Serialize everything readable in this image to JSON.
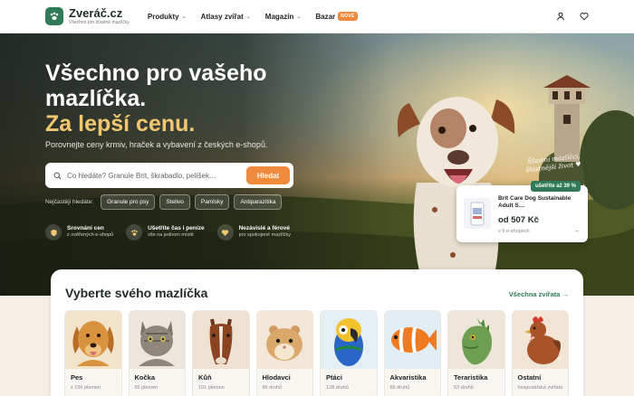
{
  "brand": {
    "name": "Zveráč.cz",
    "tagline": "Všechno pro šťastné mazlíčky"
  },
  "nav": {
    "items": [
      {
        "label": "Produkty",
        "has_dropdown": true
      },
      {
        "label": "Atlasy zvířat",
        "has_dropdown": true
      },
      {
        "label": "Magazín",
        "has_dropdown": true
      },
      {
        "label": "Bazar",
        "badge": "NOVÉ"
      }
    ],
    "icons": [
      "user-icon",
      "heart-icon"
    ]
  },
  "hero": {
    "title_line1": "Všechno pro vašeho",
    "title_line2": "mazlíčka.",
    "title_accent": "Za lepší cenu.",
    "subtitle": "Porovnejte ceny krmiv, hraček a vybavení z českých e-shopů.",
    "search": {
      "placeholder": "Co hledáte? Granule Brit, škrabadlo, pelíšek…",
      "button": "Hledat"
    },
    "popular_label": "Nejčastěji hledáte:",
    "popular": [
      "Granule pro psy",
      "Stelivo",
      "Pamlsky",
      "Antiparazitika"
    ],
    "features": [
      {
        "title": "Srovnání cen",
        "sub": "z ověřených e-shopů",
        "icon": "shield-icon"
      },
      {
        "title": "Ušetříte čas i peníze",
        "sub": "vše na jednom místě",
        "icon": "paw-icon"
      },
      {
        "title": "Nezávislé a férové",
        "sub": "pro spokojené mazlíčky",
        "icon": "heart-icon"
      }
    ],
    "script_line1": "Šťastní mazlíčci,",
    "script_line2": "šťastnější život ♥",
    "deal": {
      "badge": "ušetříte až 39 %",
      "name": "Brit Care Dog Sustainable Adult S…",
      "price": "od 507 Kč",
      "shops": "v 9 e-shopech"
    }
  },
  "categories": {
    "title": "Vyberte svého mazlíčka",
    "link": "Všechna zvířata →",
    "items": [
      {
        "name": "Pes",
        "count": "z 156 plemen",
        "icon": "dog-icon",
        "bg": "#f3e3cb"
      },
      {
        "name": "Kočka",
        "count": "55 plemen",
        "icon": "cat-icon",
        "bg": "#ebe6de"
      },
      {
        "name": "Kůň",
        "count": "101 plemen",
        "icon": "horse-icon",
        "bg": "#f0e2d2"
      },
      {
        "name": "Hlodavci",
        "count": "96 druhů",
        "icon": "hamster-icon",
        "bg": "#f2e7d8"
      },
      {
        "name": "Ptáci",
        "count": "128 druhů",
        "icon": "parrot-icon",
        "bg": "#e5eef2"
      },
      {
        "name": "Akvaristika",
        "count": "66 druhů",
        "icon": "fish-icon",
        "bg": "#e2eef4"
      },
      {
        "name": "Teraristika",
        "count": "53 druhů",
        "icon": "iguana-icon",
        "bg": "#eee6d9"
      },
      {
        "name": "Ostatní",
        "count": "hospodářská zvířata",
        "icon": "hen-icon",
        "bg": "#f2e5d6"
      }
    ]
  }
}
